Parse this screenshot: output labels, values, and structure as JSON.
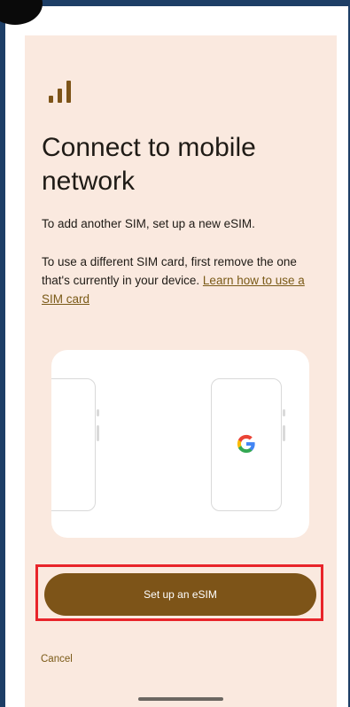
{
  "screen": {
    "title": "Connect to mobile network",
    "paragraph1": "To add another SIM, set up a new eSIM.",
    "paragraph2_text": "To use a different SIM card, first remove the one that's currently in your device. ",
    "paragraph2_link": "Learn how to use a SIM card",
    "primary_button": "Set up an eSIM",
    "secondary_button": "Cancel"
  },
  "colors": {
    "background": "#fae9df",
    "accent": "#7d5418",
    "link": "#7a5a17",
    "highlight": "#e8242a"
  },
  "icons": [
    "signal-bars-icon",
    "google-g-icon"
  ]
}
